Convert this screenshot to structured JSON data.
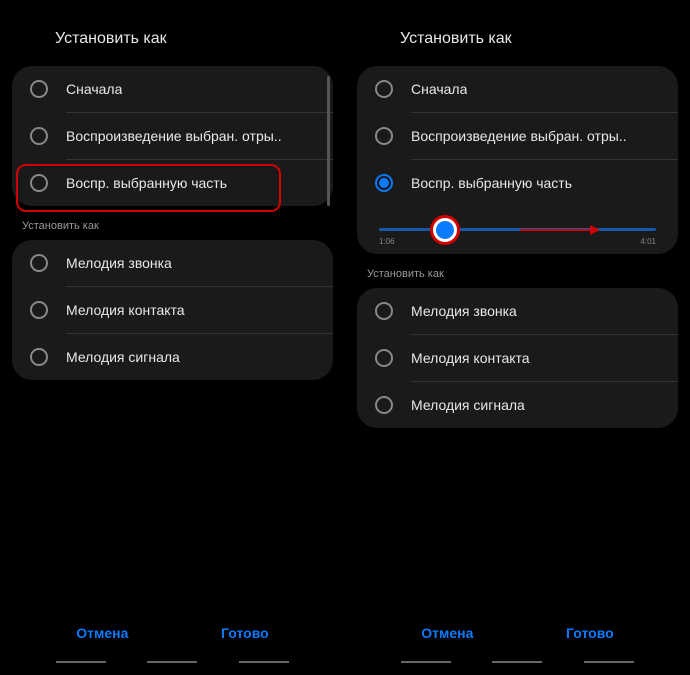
{
  "left": {
    "title": "Установить как",
    "options1": [
      "Сначала",
      "Воспроизведение выбран. отры..",
      "Воспр. выбранную часть"
    ],
    "subtitle": "Установить как",
    "options2": [
      "Мелодия звонка",
      "Мелодия контакта",
      "Мелодия сигнала"
    ],
    "cancel": "Отмена",
    "done": "Готово"
  },
  "right": {
    "title": "Установить как",
    "options1": [
      "Сначала",
      "Воспроизведение выбран. отры..",
      "Воспр. выбранную часть"
    ],
    "slider": {
      "start_time": "1:06",
      "end_time": "4:01"
    },
    "subtitle": "Установить как",
    "options2": [
      "Мелодия звонка",
      "Мелодия контакта",
      "Мелодия сигнала"
    ],
    "cancel": "Отмена",
    "done": "Готово"
  }
}
